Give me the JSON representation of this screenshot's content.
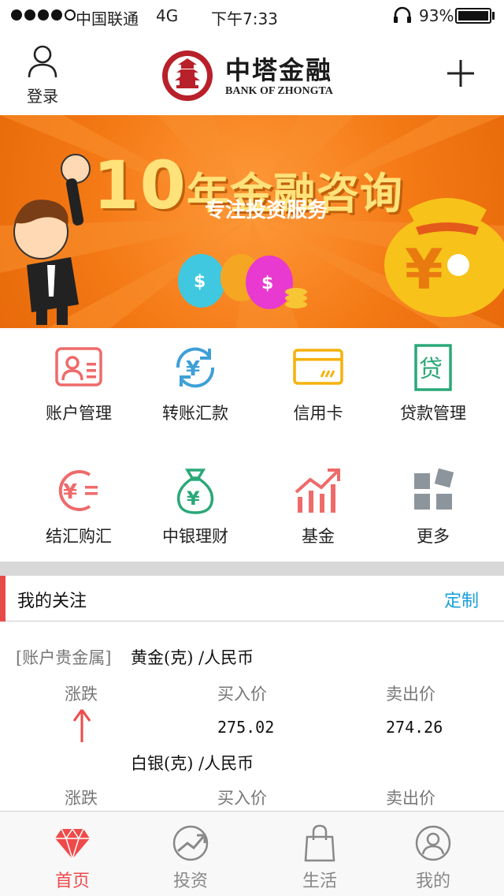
{
  "status": {
    "carrier": "中国联通",
    "network": "4G",
    "time": "下午7:33",
    "battery": "93%"
  },
  "header": {
    "login": "登录",
    "bank_cn": "中塔金融",
    "bank_en": "BANK OF ZHONGTA"
  },
  "banner": {
    "title_num": "10",
    "title_text": "年金融咨询",
    "subtitle": "专注投资服务"
  },
  "services": [
    {
      "label": "账户管理",
      "icon": "account-card-icon"
    },
    {
      "label": "转账汇款",
      "icon": "transfer-cycle-icon"
    },
    {
      "label": "信用卡",
      "icon": "credit-card-icon"
    },
    {
      "label": "贷款管理",
      "icon": "loan-icon"
    },
    {
      "label": "结汇购汇",
      "icon": "exchange-icon"
    },
    {
      "label": "中银理财",
      "icon": "money-bag-icon"
    },
    {
      "label": "基金",
      "icon": "fund-chart-icon"
    },
    {
      "label": "更多",
      "icon": "more-grid-icon"
    }
  ],
  "follow": {
    "title": "我的关注",
    "action": "定制"
  },
  "quotes": {
    "category": "[账户贵金属]",
    "items": [
      {
        "name": "黄金(克) /人民币",
        "change_label": "涨跌",
        "buy_label": "买入价",
        "sell_label": "卖出价",
        "buy": "275.02",
        "sell": "274.26",
        "trend": "up"
      },
      {
        "name": "白银(克) /人民币",
        "change_label": "涨跌",
        "buy_label": "买入价",
        "sell_label": "卖出价"
      }
    ]
  },
  "tabs": [
    {
      "label": "首页",
      "active": true
    },
    {
      "label": "投资",
      "active": false
    },
    {
      "label": "生活",
      "active": false
    },
    {
      "label": "我的",
      "active": false
    }
  ],
  "colors": {
    "accent": "#e84a4a",
    "link": "#1aa0d8",
    "banner": "#f47a16"
  }
}
